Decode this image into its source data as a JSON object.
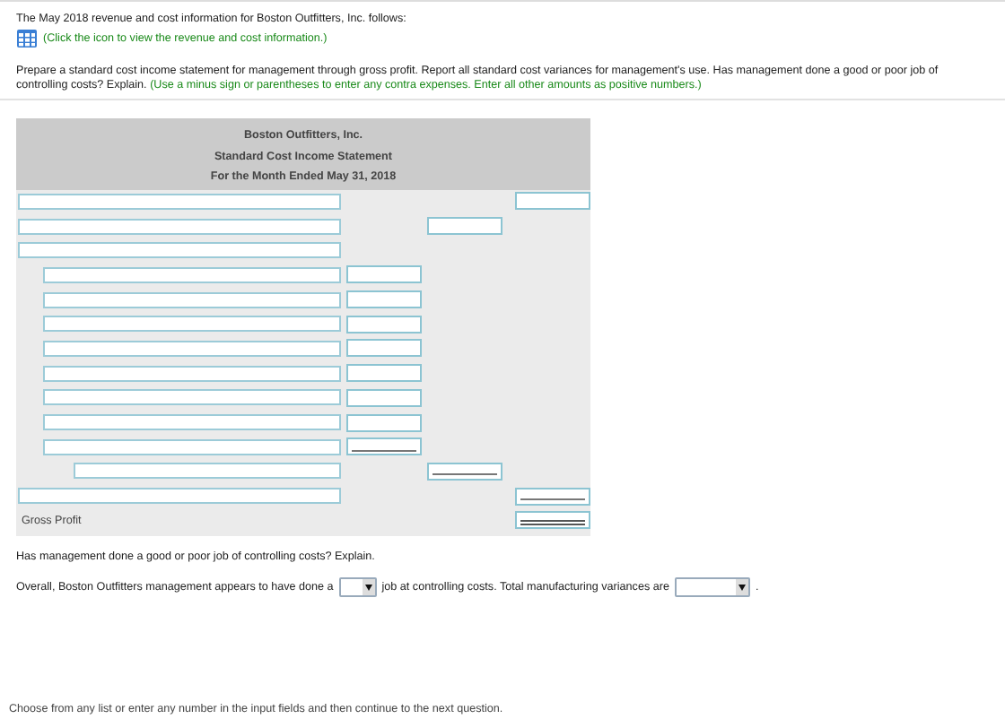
{
  "intro": "The May 2018 revenue and cost information for Boston Outfitters, Inc. follows:",
  "info_link": "(Click the icon to view the revenue and cost information.)",
  "instructions": "Prepare a standard cost income statement for management through gross profit. Report all standard cost variances for management's use. Has management done a good or poor job of controlling costs? Explain.",
  "instructions_hint": "(Use a minus sign or parentheses to enter any contra expenses. Enter all other amounts as positive numbers.)",
  "statement": {
    "header": [
      "Boston Outfitters, Inc.",
      "Standard Cost Income Statement",
      "For the Month Ended May 31, 2018"
    ],
    "rows": [
      {
        "kind": "revenue"
      },
      {
        "kind": "section"
      },
      {
        "kind": "caption"
      },
      {
        "kind": "item"
      },
      {
        "kind": "item"
      },
      {
        "kind": "item"
      },
      {
        "kind": "item"
      },
      {
        "kind": "item"
      },
      {
        "kind": "item"
      },
      {
        "kind": "item"
      },
      {
        "kind": "lastitem"
      },
      {
        "kind": "sum"
      },
      {
        "kind": "total"
      },
      {
        "kind": "result",
        "label": "Gross Profit"
      }
    ]
  },
  "question": "Has management done a good or poor job of controlling costs? Explain.",
  "answer": {
    "before": "Overall, Boston Outfitters management appears to have done a",
    "middle": "job at controlling costs. Total manufacturing variances are",
    "after": "."
  },
  "footer": "Choose from any list or enter any number in the input fields and then continue to the next question."
}
